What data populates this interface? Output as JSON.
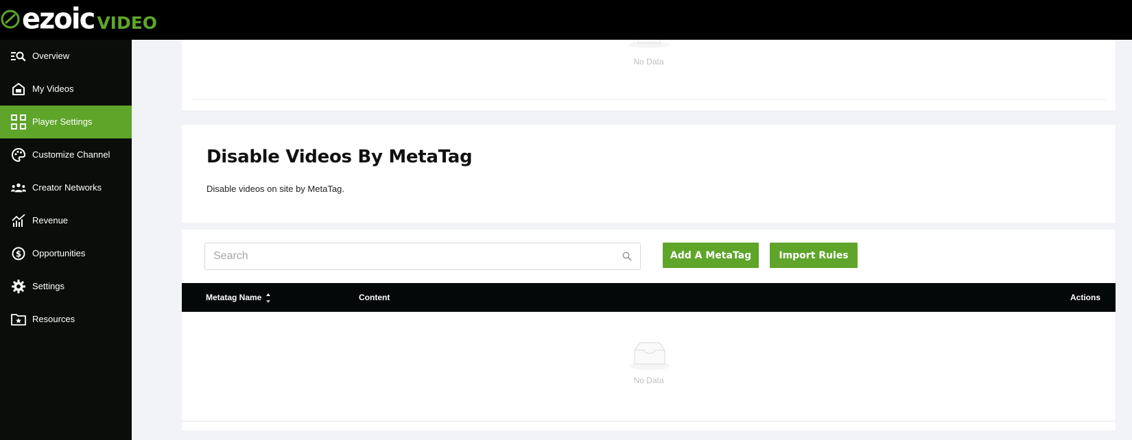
{
  "brand": {
    "logo_word": "ezoic",
    "logo_suffix": "VIDEO",
    "accent": "#5ea52a"
  },
  "sidebar": {
    "items": [
      {
        "label": "Overview",
        "icon": "overview-icon",
        "active": false
      },
      {
        "label": "My Videos",
        "icon": "home-video-icon",
        "active": false
      },
      {
        "label": "Player Settings",
        "icon": "grid-icon",
        "active": true
      },
      {
        "label": "Customize Channel",
        "icon": "palette-icon",
        "active": false
      },
      {
        "label": "Creator Networks",
        "icon": "people-icon",
        "active": false
      },
      {
        "label": "Revenue",
        "icon": "chart-icon",
        "active": false
      },
      {
        "label": "Opportunities",
        "icon": "dollar-icon",
        "active": false
      },
      {
        "label": "Settings",
        "icon": "gear-icon",
        "active": false
      },
      {
        "label": "Resources",
        "icon": "folder-star-icon",
        "active": false
      }
    ]
  },
  "top_card": {
    "empty_text": "No Data"
  },
  "section": {
    "title": "Disable Videos By MetaTag",
    "description": "Disable videos on site by MetaTag."
  },
  "toolbar": {
    "search_placeholder": "Search",
    "add_label": "Add A MetaTag",
    "import_label": "Import Rules"
  },
  "table": {
    "columns": [
      "Metatag Name",
      "Content",
      "Actions"
    ],
    "rows": [],
    "empty_text": "No Data"
  }
}
